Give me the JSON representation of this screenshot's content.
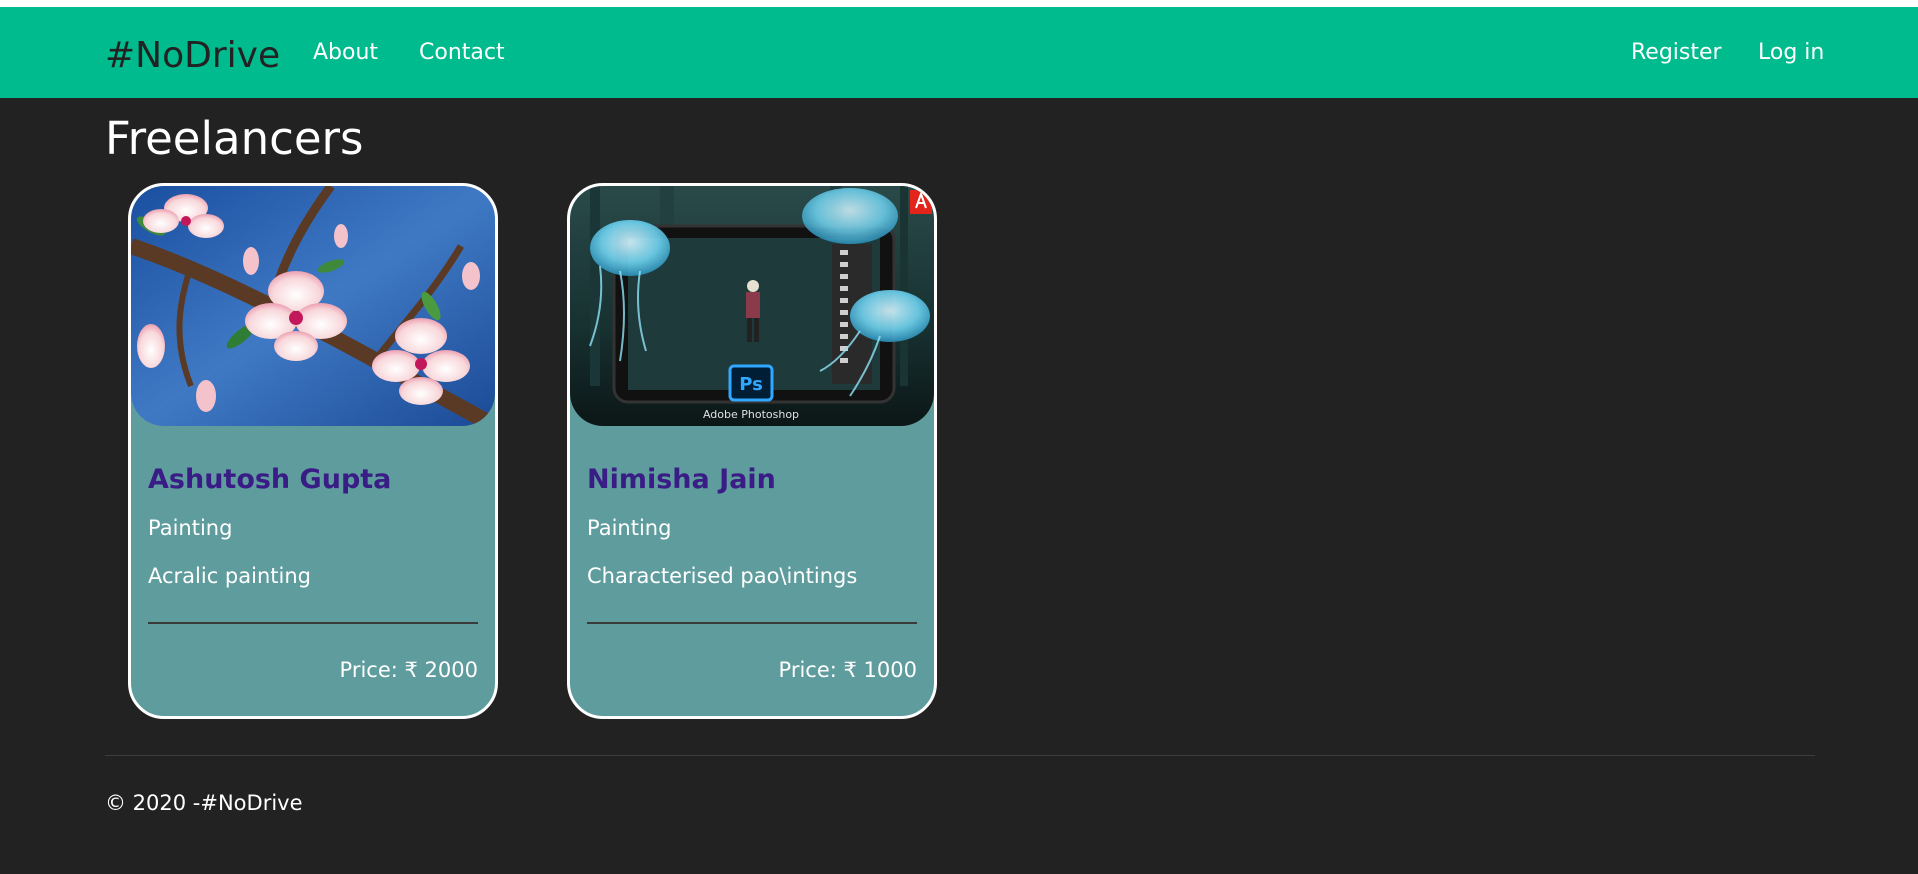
{
  "brand": "#NoDrive",
  "nav": {
    "about": "About",
    "contact": "Contact",
    "register": "Register",
    "login": "Log in"
  },
  "page": {
    "title": "Freelancers"
  },
  "cards": [
    {
      "name": "Ashutosh Gupta",
      "category": "Painting",
      "description": "Acralic painting",
      "price": "Price: ₹ 2000"
    },
    {
      "name": "Nimisha Jain",
      "category": "Painting",
      "description": "Characterised pao\\intings",
      "price": "Price: ₹ 1000",
      "image_caption": "Adobe Photoshop",
      "image_badge": "Ps",
      "logo": "Adobe"
    }
  ],
  "footer": {
    "text": "© 2020 -#NoDrive"
  },
  "colors": {
    "navbar": "#00bb8d",
    "background": "#222222",
    "card": "#5f9c9d",
    "name": "#3a1c86"
  }
}
